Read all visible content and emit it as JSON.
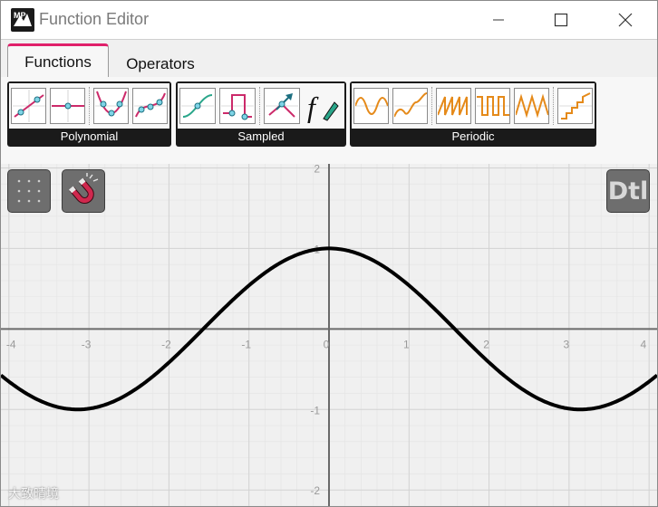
{
  "window": {
    "title": "Function Editor",
    "app_logo_text": "MP",
    "controls": [
      "minimize",
      "maximize",
      "close"
    ]
  },
  "tabs": [
    {
      "label": "Functions",
      "active": true
    },
    {
      "label": "Operators",
      "active": false
    }
  ],
  "ribbon": {
    "groups": [
      {
        "label": "Polynomial",
        "tiles": [
          "linear-ramp-icon",
          "constant-icon",
          "parabola-icon",
          "cubic-icon"
        ]
      },
      {
        "label": "Sampled",
        "tiles": [
          "smooth-step-icon",
          "pulse-step-icon",
          "arrow-curve-icon",
          "custom-function-icon"
        ]
      },
      {
        "label": "Periodic",
        "tiles": [
          "sine-wave-icon",
          "damped-wave-icon",
          "sawtooth-wave-icon",
          "square-wave-icon",
          "triangle-wave-icon",
          "staircase-icon"
        ]
      }
    ],
    "custom_function_glyph": "f"
  },
  "plot": {
    "snap_toggle_icon": "magnet-icon",
    "grid_toggle_icon": "grid-dots-icon",
    "dtl_label": "Dtl",
    "x_ticks": [
      "-4",
      "-3",
      "-2",
      "-1",
      "0",
      "1",
      "2",
      "3",
      "4"
    ],
    "y_ticks": [
      "2",
      "1",
      "-1",
      "-2"
    ]
  },
  "chart_data": {
    "type": "line",
    "function": "cos(x)",
    "xlim": [
      -4.1,
      4.1
    ],
    "ylim": [
      -2.2,
      2.05
    ],
    "grid": true,
    "series": [
      {
        "color": "#000000"
      }
    ]
  },
  "watermark": "大致晴境",
  "colors": {
    "accent": "#e0206a",
    "tile_pink": "#cc2a6a",
    "tile_teal": "#2aa68a",
    "tile_orange": "#e58a1a",
    "curve": "#000000",
    "axis": "#6a6a6a",
    "grid": "#dcdcdc",
    "dtl_text": "#d8d8d8"
  }
}
